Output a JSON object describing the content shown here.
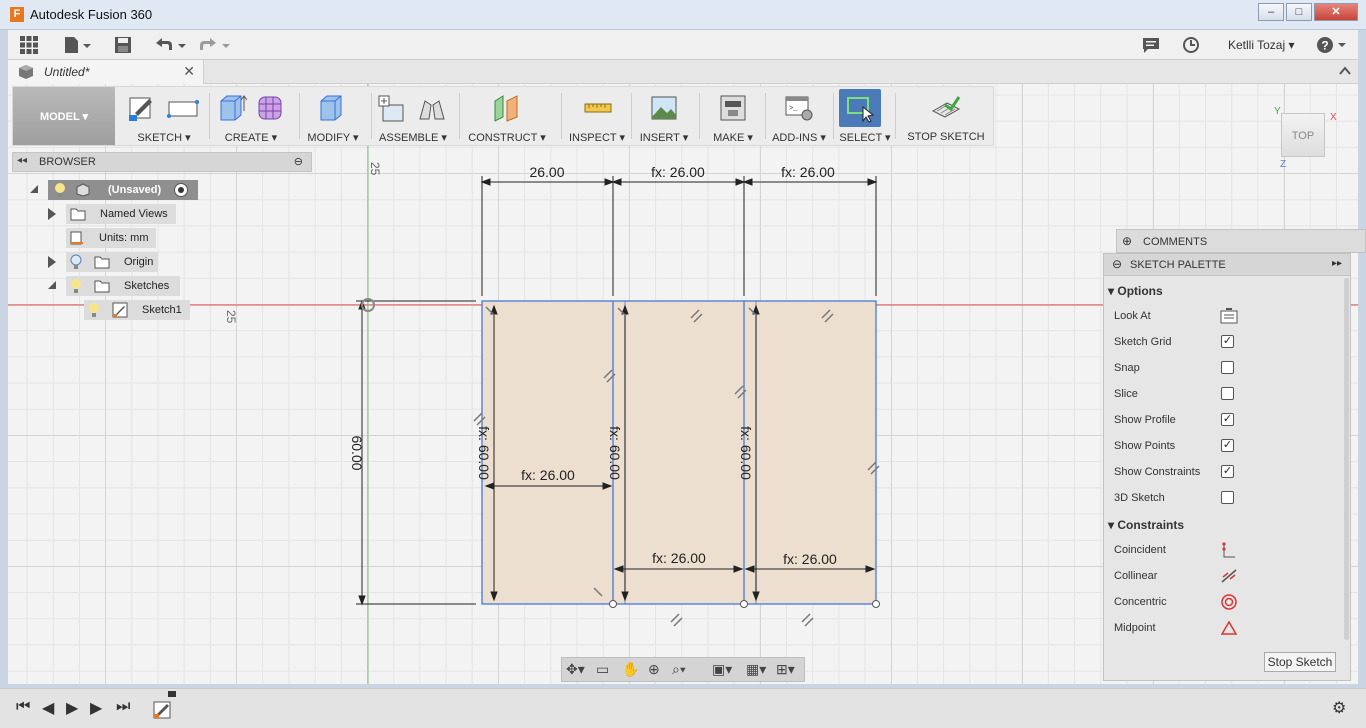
{
  "window": {
    "title": "Autodesk Fusion 360",
    "app_icon": "F",
    "minimize": "–",
    "maximize": "□",
    "close": "✕"
  },
  "apptop": {
    "user": "Ketlli Tozaj ▾",
    "icons": [
      "grid-icon",
      "file-icon",
      "save-icon",
      "undo-icon",
      "redo-icon",
      "comment-icon",
      "clock-icon",
      "help-icon"
    ]
  },
  "tab": {
    "title": "Untitled*",
    "close": "✕"
  },
  "ribbon": {
    "workspace": "MODEL",
    "groups": [
      "SKETCH ▾",
      "CREATE ▾",
      "MODIFY ▾",
      "ASSEMBLE ▾",
      "CONSTRUCT ▾",
      "INSPECT ▾",
      "INSERT ▾",
      "MAKE ▾",
      "ADD-INS ▾",
      "SELECT ▾",
      "STOP SKETCH"
    ]
  },
  "browser": {
    "title": "BROWSER",
    "nodes": [
      "(Unsaved)",
      "Named Views",
      "Units: mm",
      "Origin",
      "Sketches",
      "Sketch1"
    ]
  },
  "viewcube": {
    "face": "TOP",
    "axes": [
      "Y",
      "X",
      "Z"
    ]
  },
  "comments": {
    "title": "COMMENTS"
  },
  "palette": {
    "title": "SKETCH PALETTE",
    "options_title": "Options",
    "options": [
      {
        "label": "Look At",
        "type": "button",
        "checked": null
      },
      {
        "label": "Sketch Grid",
        "type": "checkbox",
        "checked": true
      },
      {
        "label": "Snap",
        "type": "checkbox",
        "checked": false
      },
      {
        "label": "Slice",
        "type": "checkbox",
        "checked": false
      },
      {
        "label": "Show Profile",
        "type": "checkbox",
        "checked": true
      },
      {
        "label": "Show Points",
        "type": "checkbox",
        "checked": true
      },
      {
        "label": "Show Constraints",
        "type": "checkbox",
        "checked": true
      },
      {
        "label": "3D Sketch",
        "type": "checkbox",
        "checked": false
      }
    ],
    "constraints_title": "Constraints",
    "constraints": [
      "Coincident",
      "Collinear",
      "Concentric",
      "Midpoint"
    ],
    "stop_button": "Stop Sketch"
  },
  "sketch": {
    "dims_top": [
      "26.00",
      "fx: 26.00",
      "fx: 26.00"
    ],
    "dim_left": "60.00",
    "dims_vertical": [
      "fx: 60.00",
      "fx: 60.00",
      "fx: 60.00"
    ],
    "dim_mid": "fx: 26.00",
    "dims_bottom": [
      "fx: 26.00",
      "fx: 26.00"
    ],
    "grid_label_top": "25",
    "grid_label_left": "25",
    "colors": {
      "profile_fill": "#ecdfcf",
      "edges": "#3a6fd8",
      "x_axis": "#e05050",
      "y_axis": "#7ec27e"
    }
  }
}
